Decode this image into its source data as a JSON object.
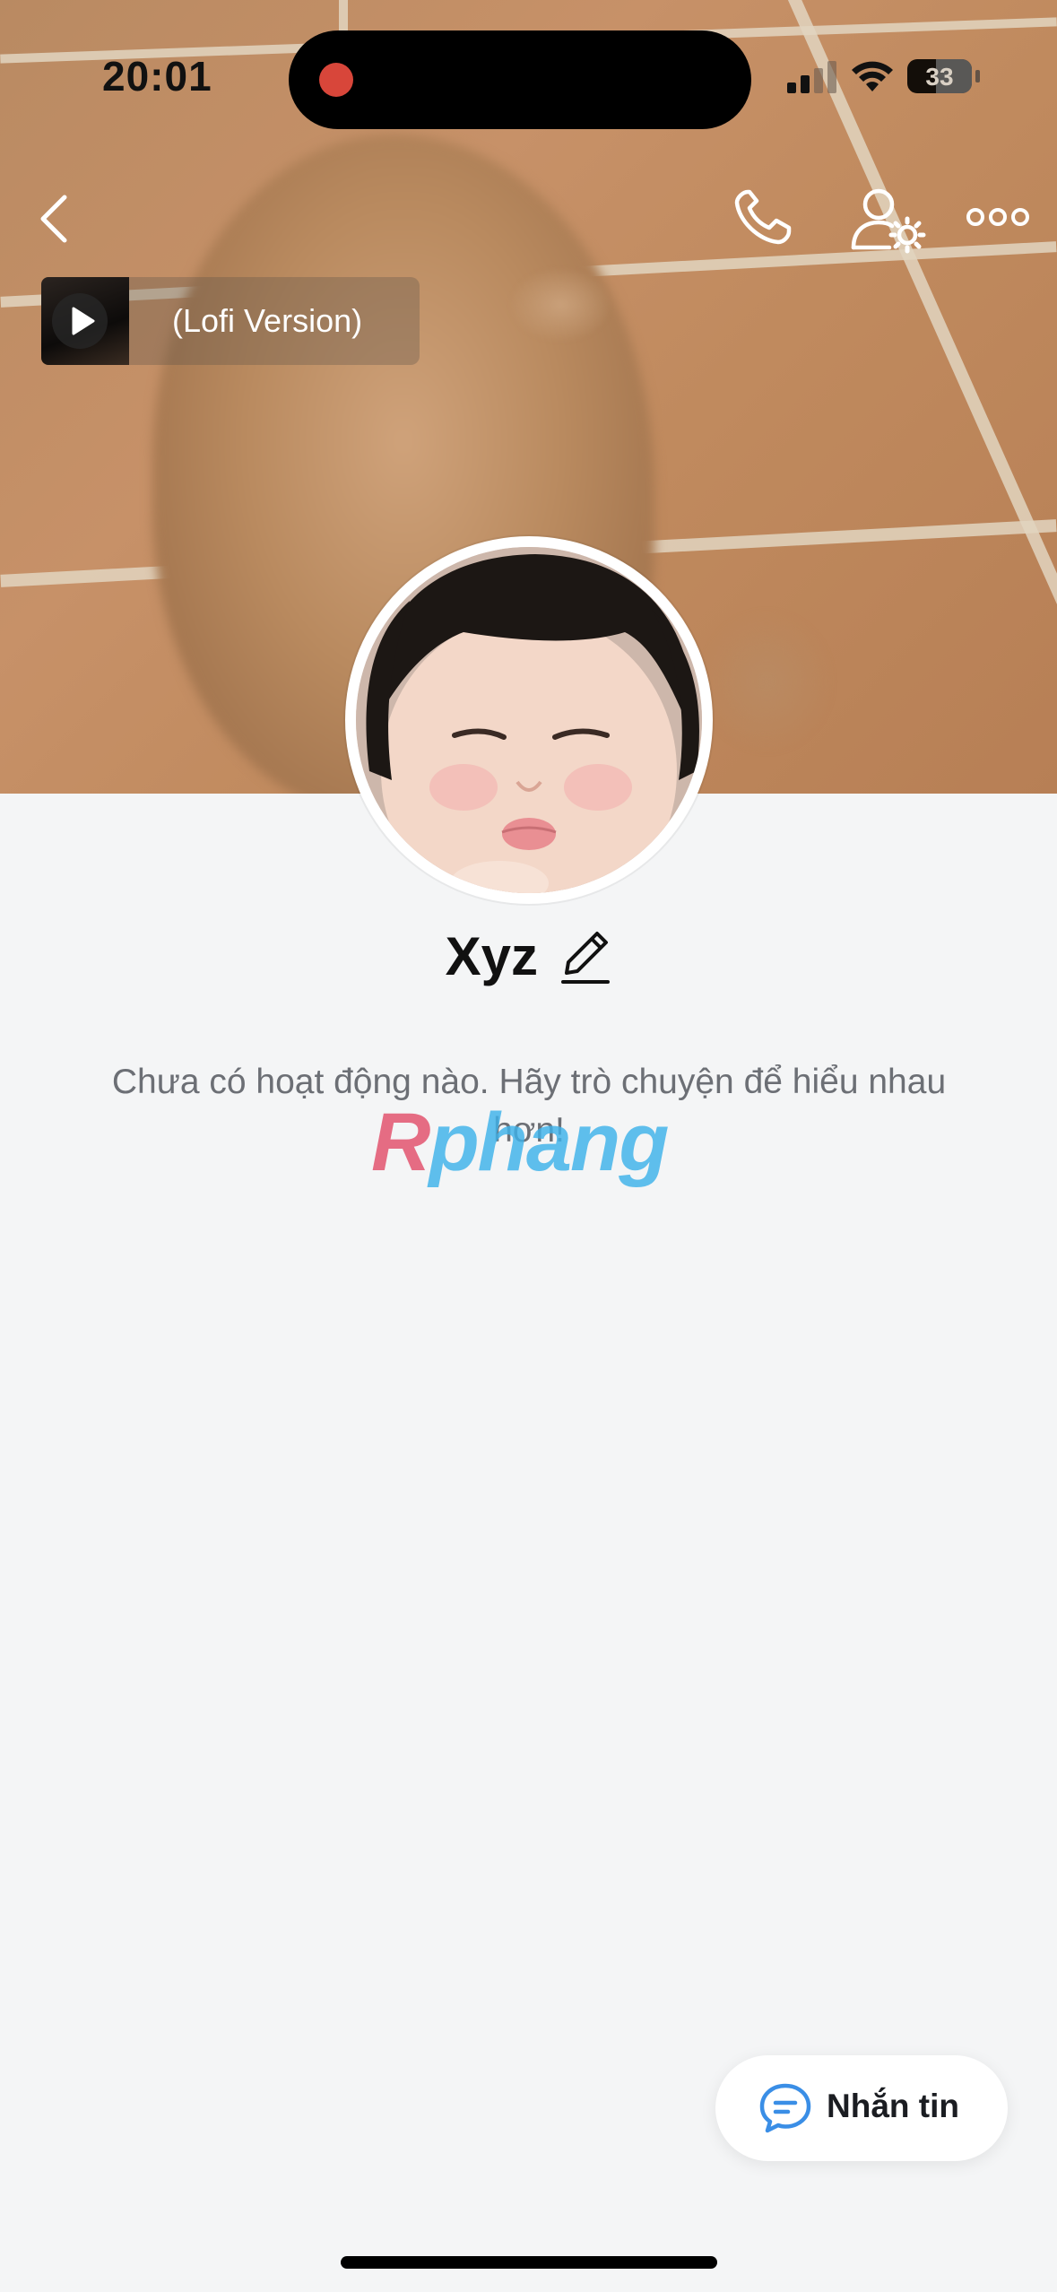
{
  "status_bar": {
    "time": "20:01",
    "battery": "33"
  },
  "music": {
    "title": "(Lofi Version)"
  },
  "profile": {
    "name": "Xyz"
  },
  "empty_state": {
    "message": "Chưa có hoạt động nào. Hãy trò chuyện để hiểu nhau hơn!"
  },
  "watermark": {
    "first": "R",
    "rest": "phang"
  },
  "actions": {
    "message_label": "Nhắn tin"
  },
  "colors": {
    "accent": "#3a8ee6",
    "recording": "#d8463a",
    "background": "#f4f5f6"
  }
}
